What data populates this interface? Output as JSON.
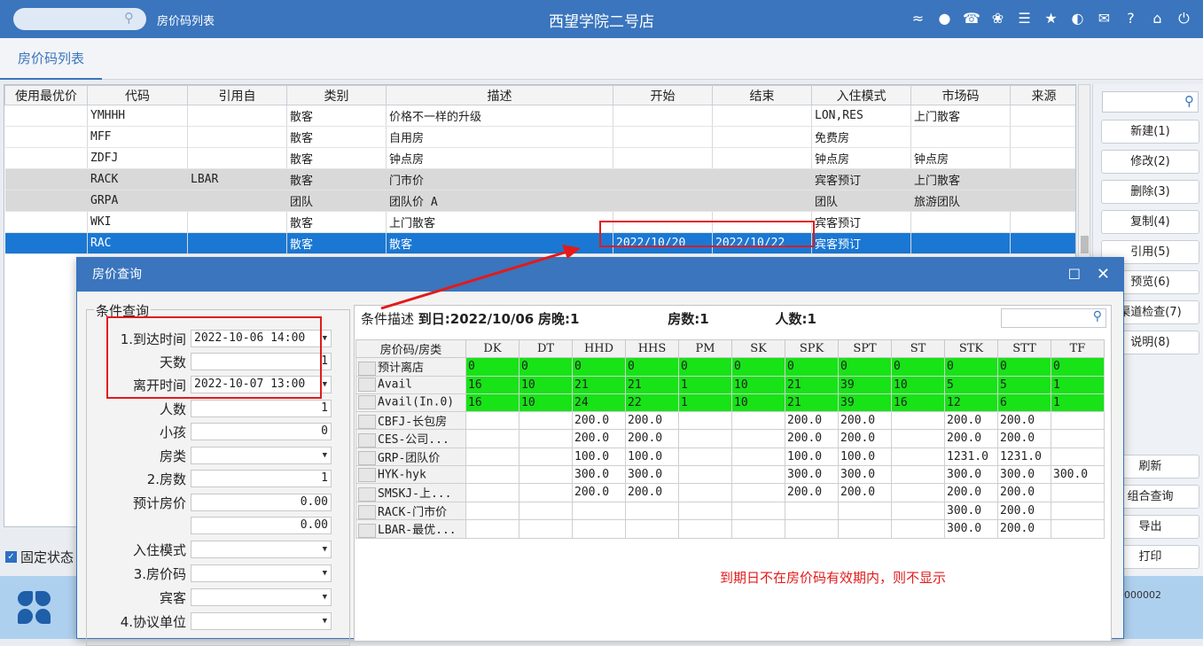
{
  "topbar": {
    "breadcrumb": "房价码列表",
    "title": "西望学院二号店",
    "icons": [
      "wifi-icon",
      "chat-icon",
      "phone-icon",
      "palette-icon",
      "menu-icon",
      "star-icon",
      "contrast-icon",
      "mail-icon",
      "help-icon",
      "home-icon",
      "power-icon"
    ]
  },
  "tab": {
    "label": "房价码列表"
  },
  "main_table": {
    "columns": [
      "使用最优价",
      "代码",
      "引用自",
      "类别",
      "描述",
      "开始",
      "结束",
      "入住模式",
      "市场码",
      "来源"
    ],
    "rows": [
      {
        "code": "YMHHH",
        "ref": "",
        "type": "散客",
        "desc": "价格不一样的升级",
        "start": "",
        "end": "",
        "mode": "LON,RES",
        "market": "上门散客",
        "source": ""
      },
      {
        "code": "MFF",
        "ref": "",
        "type": "散客",
        "desc": "自用房",
        "start": "",
        "end": "",
        "mode": "免费房",
        "market": "",
        "source": ""
      },
      {
        "code": "ZDFJ",
        "ref": "",
        "type": "散客",
        "desc": "钟点房",
        "start": "",
        "end": "",
        "mode": "钟点房",
        "market": "钟点房",
        "source": ""
      },
      {
        "code": "RACK",
        "ref": "LBAR",
        "type": "散客",
        "desc": "门市价",
        "start": "",
        "end": "",
        "mode": "宾客预订",
        "market": "上门散客",
        "source": ""
      },
      {
        "code": "GRPA",
        "ref": "",
        "type": "团队",
        "desc": "团队价 A",
        "start": "",
        "end": "",
        "mode": "团队",
        "market": "旅游团队",
        "source": ""
      },
      {
        "code": "WKI",
        "ref": "",
        "type": "散客",
        "desc": "上门散客",
        "start": "",
        "end": "",
        "mode": "宾客预订",
        "market": "",
        "source": ""
      },
      {
        "code": "RAC",
        "ref": "",
        "type": "散客",
        "desc": "散客",
        "start": "2022/10/20",
        "end": "2022/10/22",
        "mode": "宾客预订",
        "market": "",
        "source": ""
      }
    ]
  },
  "right_buttons": [
    "新建(1)",
    "修改(2)",
    "删除(3)",
    "复制(4)",
    "引用(5)",
    "预览(6)",
    "渠道检查(7)",
    "说明(8)",
    "刷新",
    "组合查询",
    "导出",
    "打印"
  ],
  "fixed_status_label": "固定状态",
  "bottom_code": "000002",
  "dialog": {
    "title": "房价查询",
    "condition_label": "条件查询",
    "fields": [
      {
        "label": "1.到达时间",
        "value": "2022-10-06 14:00",
        "dropdown": true
      },
      {
        "label": "天数",
        "value": "1",
        "dropdown": false
      },
      {
        "label": "离开时间",
        "value": "2022-10-07 13:00",
        "dropdown": true
      },
      {
        "label": "人数",
        "value": "1",
        "dropdown": false
      },
      {
        "label": "小孩",
        "value": "0",
        "dropdown": false
      },
      {
        "label": "房类",
        "value": "",
        "dropdown": true
      },
      {
        "label": "2.房数",
        "value": "1",
        "dropdown": false
      },
      {
        "label": "预计房价",
        "value": "0.00",
        "dropdown": false
      },
      {
        "label": "",
        "value": "0.00",
        "dropdown": false
      },
      {
        "label": "入住模式",
        "value": "",
        "dropdown": true
      },
      {
        "label": "3.房价码",
        "value": "",
        "dropdown": true
      },
      {
        "label": "宾客",
        "value": "",
        "dropdown": true
      },
      {
        "label": "4.协议单位",
        "value": "",
        "dropdown": true
      }
    ],
    "summary": {
      "prefix": "条件描述",
      "arrival": "到日:2022/10/06",
      "nights": "房晚:1",
      "rooms": "房数:1",
      "persons": "人数:1"
    },
    "rate_table": {
      "corner": "房价码/房类",
      "columns": [
        "DK",
        "DT",
        "HHD",
        "HHS",
        "PM",
        "SK",
        "SPK",
        "SPT",
        "ST",
        "STK",
        "STT",
        "TF"
      ],
      "rows": [
        {
          "name": "预计离店",
          "green": true,
          "cells": [
            "0",
            "0",
            "0",
            "0",
            "0",
            "0",
            "0",
            "0",
            "0",
            "0",
            "0",
            "0"
          ]
        },
        {
          "name": "Avail",
          "green": true,
          "cells": [
            "16",
            "10",
            "21",
            "21",
            "1",
            "10",
            "21",
            "39",
            "10",
            "5",
            "5",
            "1"
          ]
        },
        {
          "name": "Avail(In.0)",
          "green": true,
          "cells": [
            "16",
            "10",
            "24",
            "22",
            "1",
            "10",
            "21",
            "39",
            "16",
            "12",
            "6",
            "1"
          ]
        },
        {
          "name": "CBFJ-长包房",
          "green": false,
          "cells": [
            "",
            "",
            "200.0",
            "200.0",
            "",
            "",
            "200.0",
            "200.0",
            "",
            "200.0",
            "200.0",
            ""
          ]
        },
        {
          "name": "CES-公司...",
          "green": false,
          "cells": [
            "",
            "",
            "200.0",
            "200.0",
            "",
            "",
            "200.0",
            "200.0",
            "",
            "200.0",
            "200.0",
            ""
          ]
        },
        {
          "name": "GRP-团队价",
          "green": false,
          "cells": [
            "",
            "",
            "100.0",
            "100.0",
            "",
            "",
            "100.0",
            "100.0",
            "",
            "1231.0",
            "1231.0",
            ""
          ]
        },
        {
          "name": "HYK-hyk",
          "green": false,
          "cells": [
            "",
            "",
            "300.0",
            "300.0",
            "",
            "",
            "300.0",
            "300.0",
            "",
            "300.0",
            "300.0",
            "300.0"
          ]
        },
        {
          "name": "SMSKJ-上...",
          "green": false,
          "cells": [
            "",
            "",
            "200.0",
            "200.0",
            "",
            "",
            "200.0",
            "200.0",
            "",
            "200.0",
            "200.0",
            ""
          ]
        },
        {
          "name": "RACK-门市价",
          "green": false,
          "cells": [
            "",
            "",
            "",
            "",
            "",
            "",
            "",
            "",
            "",
            "300.0",
            "200.0",
            ""
          ]
        },
        {
          "name": "LBAR-最优...",
          "green": false,
          "cells": [
            "",
            "",
            "",
            "",
            "",
            "",
            "",
            "",
            "",
            "300.0",
            "200.0",
            ""
          ]
        }
      ]
    },
    "note": "到期日不在房价码有效期内，则不显示"
  },
  "colors": {
    "brand": "#3a75bd",
    "selected_row": "#1a78d4",
    "avail_green": "#17e317",
    "annotation_red": "#e31a1a"
  }
}
